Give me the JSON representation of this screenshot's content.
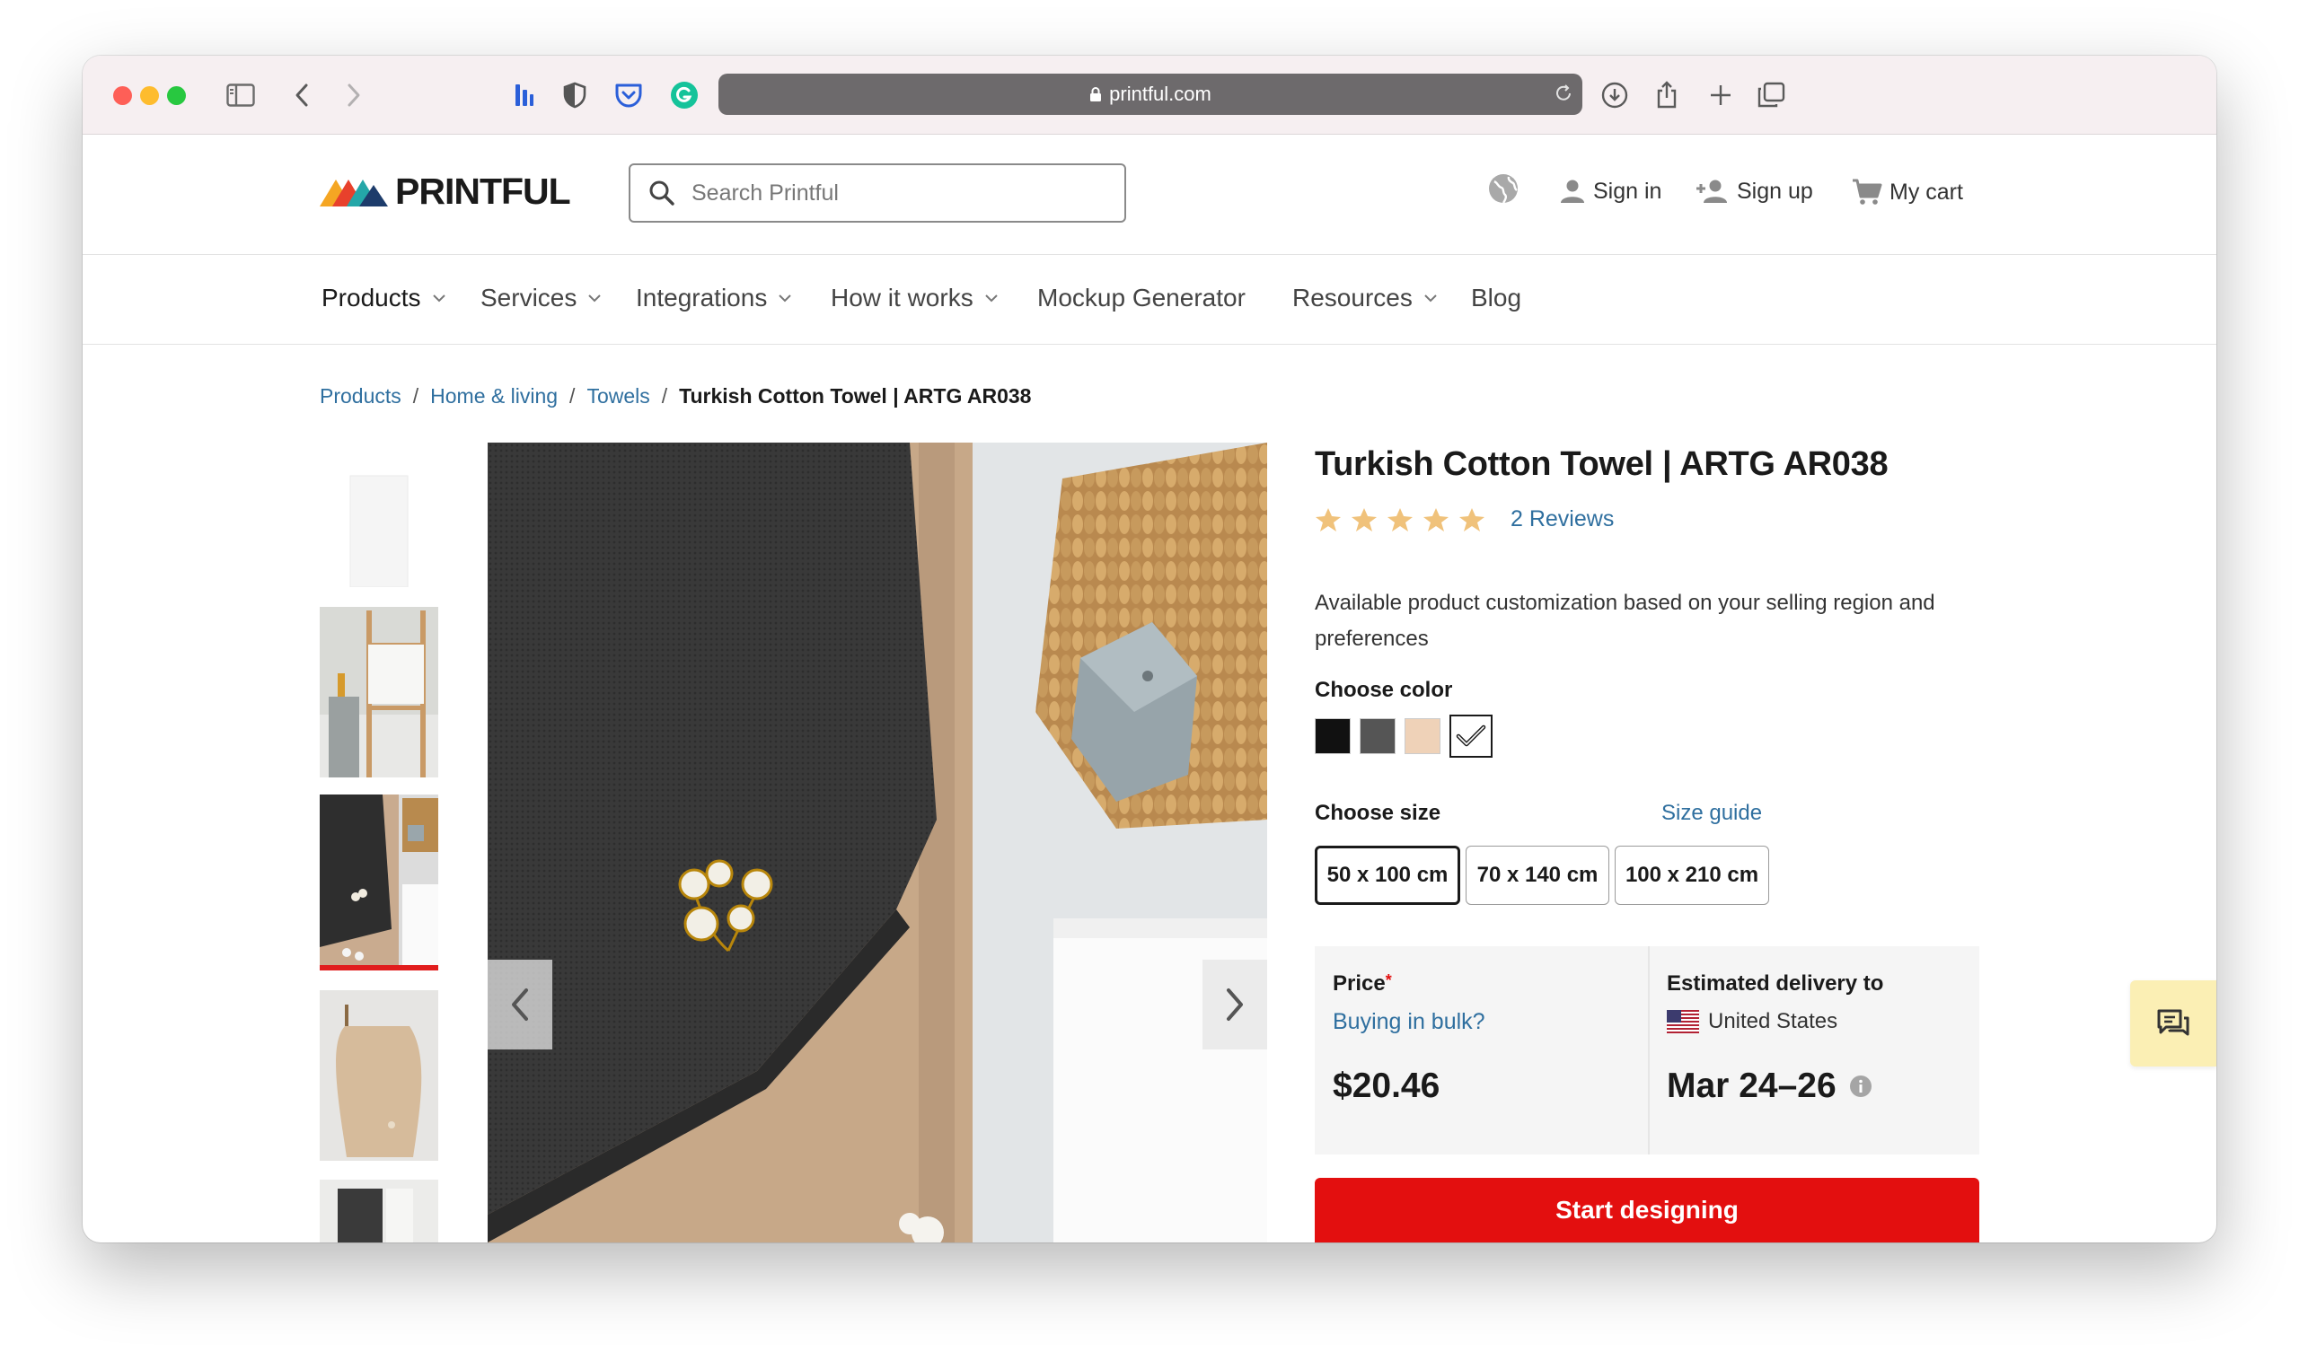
{
  "browser": {
    "url": "printful.com",
    "icons": [
      "sidebar-icon",
      "back-icon",
      "forward-icon",
      "extension-bars-icon",
      "shield-icon",
      "pocket-icon",
      "grammarly-icon",
      "lock-icon",
      "reload-icon",
      "download-icon",
      "share-icon",
      "new-tab-icon",
      "tabs-icon"
    ]
  },
  "header": {
    "logo_text": "PRINTFUL",
    "search_placeholder": "Search Printful",
    "sign_in": "Sign in",
    "sign_up": "Sign up",
    "cart": "My cart"
  },
  "nav": {
    "items": [
      {
        "label": "Products",
        "dropdown": true
      },
      {
        "label": "Services",
        "dropdown": true
      },
      {
        "label": "Integrations",
        "dropdown": true
      },
      {
        "label": "How it works",
        "dropdown": true
      },
      {
        "label": "Mockup Generator",
        "dropdown": false
      },
      {
        "label": "Resources",
        "dropdown": true
      },
      {
        "label": "Blog",
        "dropdown": false
      }
    ]
  },
  "breadcrumb": {
    "items": [
      "Products",
      "Home & living",
      "Towels"
    ],
    "separator": "/",
    "current": "Turkish Cotton Towel | ARTG AR038"
  },
  "product": {
    "title": "Turkish Cotton Towel | ARTG AR038",
    "rating": 5,
    "reviews": "2 Reviews",
    "description": "Available product customization based on your selling region and preferences",
    "color_label": "Choose color",
    "colors": [
      "#111111",
      "#555555",
      "#efd2b8",
      "#ffffff"
    ],
    "selected_color_index": 3,
    "size_label": "Choose size",
    "size_guide": "Size guide",
    "sizes": [
      "50 x 100 cm",
      "70 x 140 cm",
      "100 x 210 cm"
    ],
    "selected_size_index": 0,
    "price_label": "Price",
    "price_asterisk": "*",
    "bulk_link": "Buying in bulk?",
    "price": "$20.46",
    "delivery_label": "Estimated delivery to",
    "delivery_country": "United States",
    "delivery_dates": "Mar 24–26",
    "cta": "Start designing"
  },
  "colors": {
    "accent_red": "#e30f0f",
    "link_blue": "#2f6f9f",
    "star": "#f0c27b"
  }
}
